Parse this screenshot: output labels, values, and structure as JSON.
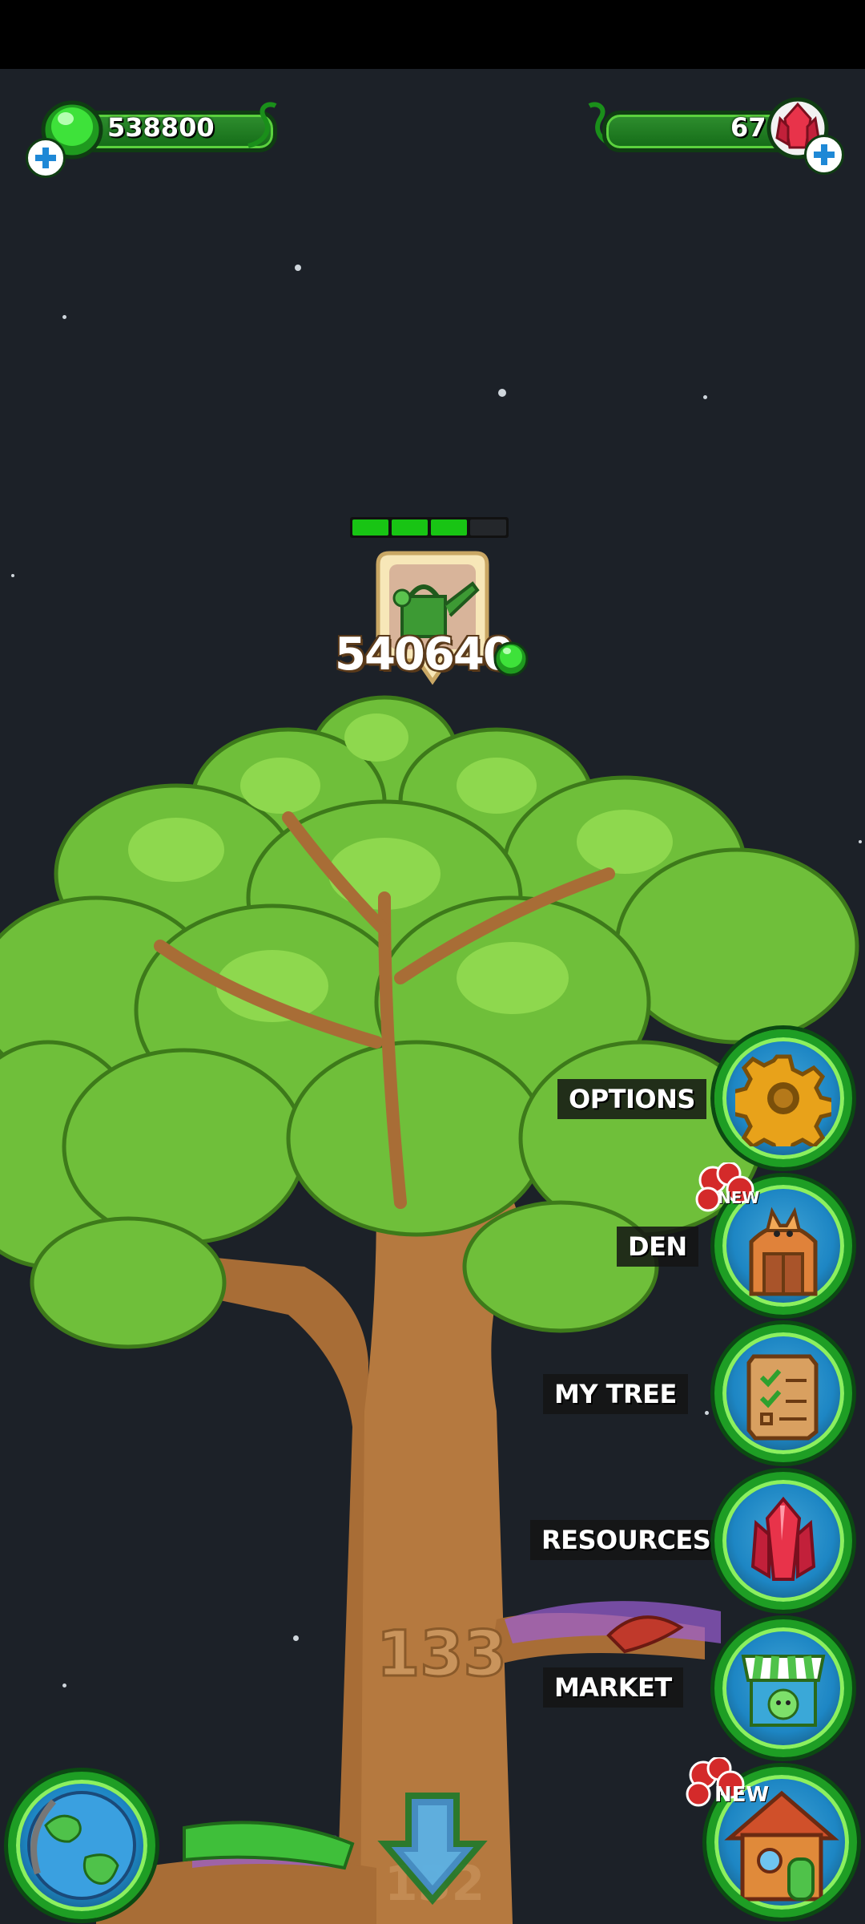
{
  "resources": {
    "gems_value": "538800",
    "crystals_value": "67"
  },
  "growth": {
    "segments_total": 4,
    "segments_filled": 3
  },
  "water_cost": "540640",
  "tree_levels": {
    "current": "133",
    "previous": "132"
  },
  "menu": [
    {
      "id": "options",
      "label": "OPTIONS",
      "icon": "gear-icon"
    },
    {
      "id": "den",
      "label": "DEN",
      "icon": "den-icon",
      "badge": "NEW"
    },
    {
      "id": "my-tree",
      "label": "MY TREE",
      "icon": "scroll-list-icon"
    },
    {
      "id": "resources",
      "label": "RESOURCES",
      "icon": "crystal-icon"
    },
    {
      "id": "market",
      "label": "MARKET",
      "icon": "market-stall-icon"
    }
  ],
  "bottom": {
    "globe_icon": "globe-icon",
    "down_arrow_icon": "down-arrow-icon",
    "house_icon": "house-icon",
    "house_badge": "NEW"
  },
  "colors": {
    "background": "#1c2128",
    "leaf": "#6fbf3a",
    "trunk": "#b5793f",
    "accent_green": "#18c414"
  }
}
